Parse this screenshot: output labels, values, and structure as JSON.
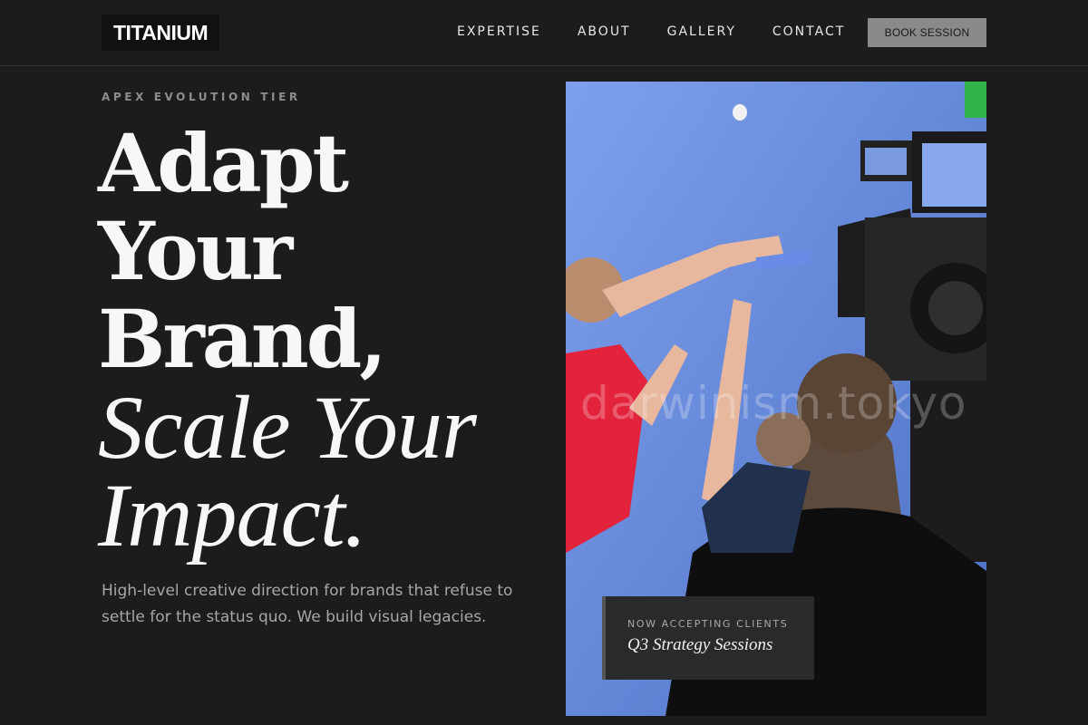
{
  "brand": {
    "logo": "TITANIUM"
  },
  "nav": {
    "items": [
      "EXPERTISE",
      "ABOUT",
      "GALLERY",
      "CONTACT"
    ],
    "cta": "BOOK SESSION"
  },
  "hero": {
    "eyebrow": "APEX EVOLUTION TIER",
    "headline": {
      "line1": "Adapt",
      "line2": "Your",
      "line3": "Brand,",
      "line4": "Scale Your",
      "line5": "Impact."
    },
    "subtext": "High-level creative direction for brands that refuse to settle for the status quo. We build visual legacies.",
    "image_watermark": "darwinism.tokyo",
    "card": {
      "label": "NOW ACCEPTING CLIENTS",
      "title": "Q3 Strategy Sessions"
    }
  },
  "colors": {
    "background": "#1c1c1c",
    "accent_button": "#8a8a8a",
    "backdrop_blue": "#5f83d4"
  }
}
